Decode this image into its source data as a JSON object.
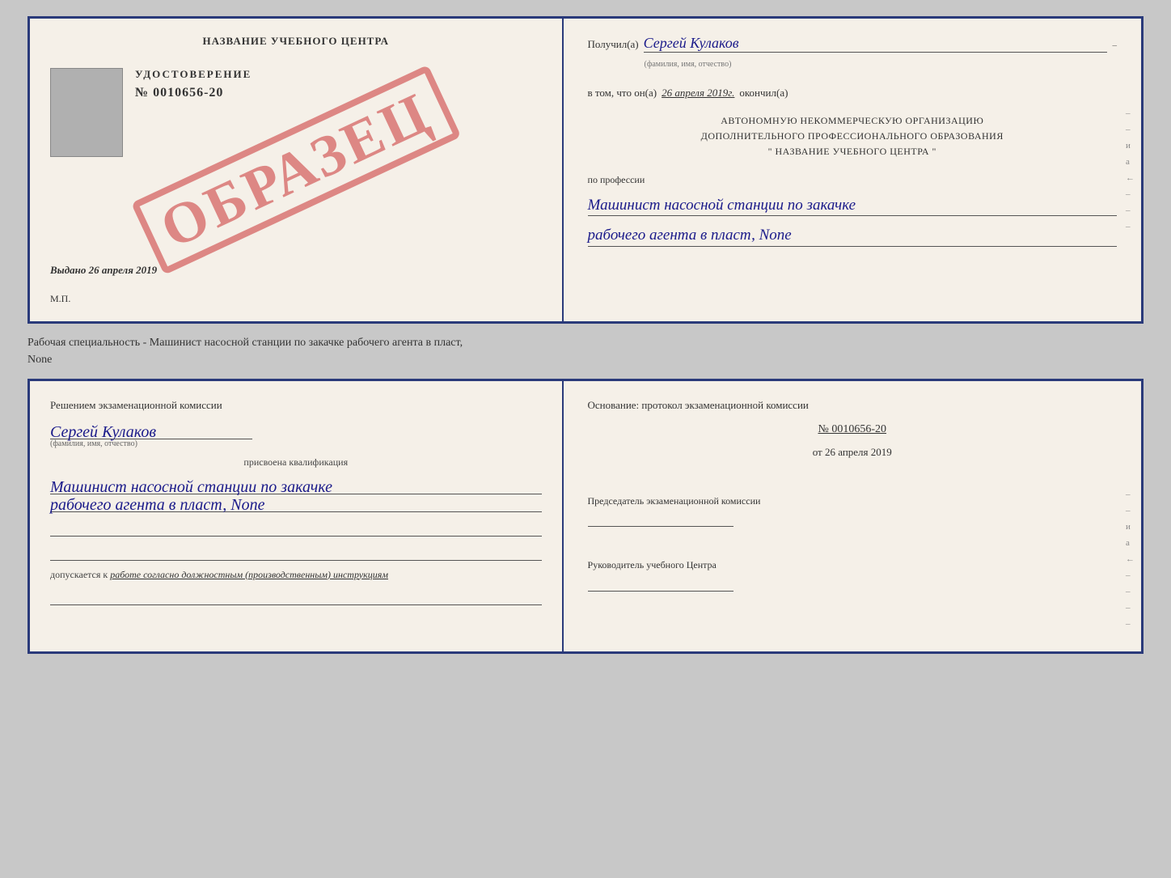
{
  "cert": {
    "title": "НАЗВАНИЕ УЧЕБНОГО ЦЕНТРА",
    "id_label": "УДОСТОВЕРЕНИЕ",
    "id_number": "№ 0010656-20",
    "issued_label": "Выдано",
    "issued_date": "26 апреля 2019",
    "mp_label": "М.П.",
    "obrazets": "ОБРАЗЕЦ",
    "right": {
      "received_label": "Получил(а)",
      "received_name": "Сергей Кулаков",
      "name_sublabel": "(фамилия, имя, отчество)",
      "date_prefix": "в том, что он(а)",
      "date_value": "26 апреля 2019г.",
      "finished_label": "окончил(а)",
      "org_line1": "АВТОНОМНУЮ НЕКОММЕРЧЕСКУЮ ОРГАНИЗАЦИЮ",
      "org_line2": "ДОПОЛНИТЕЛЬНОГО ПРОФЕССИОНАЛЬНОГО ОБРАЗОВАНИЯ",
      "org_line3": "\" НАЗВАНИЕ УЧЕБНОГО ЦЕНТРА \"",
      "profession_label": "по профессии",
      "profession_line1": "Машинист насосной станции по закачке",
      "profession_line2": "рабочего агента в пласт, None"
    }
  },
  "middle": {
    "text": "Рабочая специальность - Машинист насосной станции по закачке рабочего агента в пласт,",
    "text2": "None"
  },
  "inside": {
    "left": {
      "decision_label": "Решением экзаменационной комиссии",
      "person_name": "Сергей Кулаков",
      "name_sublabel": "(фамилия, имя, отчество)",
      "assigned_label": "присвоена квалификация",
      "qualification_line1": "Машинист насосной станции по закачке",
      "qualification_line2": "рабочего агента в пласт, None",
      "допускается_label": "допускается к",
      "допускается_value": "работе согласно должностным (производственным) инструкциям"
    },
    "right": {
      "basis_label": "Основание: протокол экзаменационной комиссии",
      "protocol_number": "№ 0010656-20",
      "protocol_date_prefix": "от",
      "protocol_date": "26 апреля 2019",
      "chairman_label": "Председатель экзаменационной комиссии",
      "head_label": "Руководитель учебного Центра"
    }
  }
}
